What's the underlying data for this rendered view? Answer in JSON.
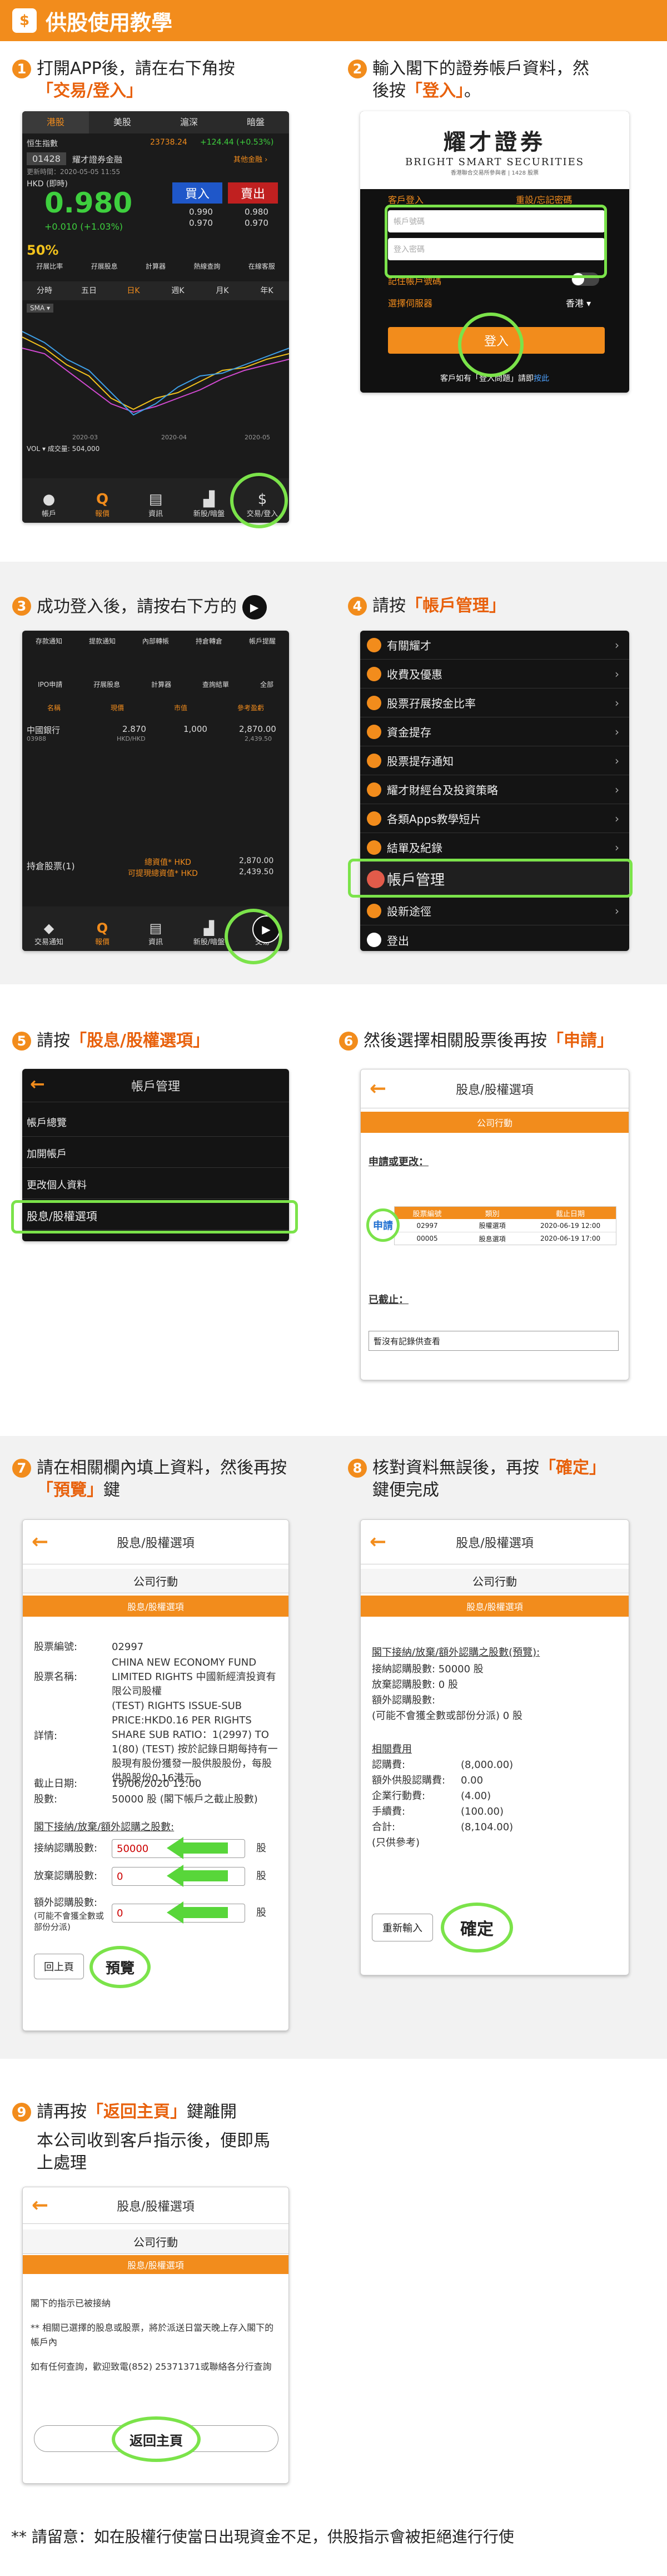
{
  "header": {
    "title": "供股使用教學",
    "icon": "$"
  },
  "steps": {
    "s1": {
      "num": "1",
      "text": "打開APP後，請在右下角按",
      "highlight": "「交易/登入」"
    },
    "s2": {
      "num": "2",
      "text": "輸入閣下的證券帳戶資料，然後按",
      "highlight": "「登入」",
      "tail": "。"
    },
    "s3": {
      "num": "3",
      "text": "成功登入後，請按右下方的"
    },
    "s4": {
      "num": "4",
      "text": "請按",
      "highlight": "「帳戶管理」"
    },
    "s5": {
      "num": "5",
      "text": "請按",
      "highlight": "「股息/股權選項」"
    },
    "s6": {
      "num": "6",
      "text": "然後選擇相關股票後再按",
      "highlight": "「申請」"
    },
    "s7": {
      "num": "7",
      "text": "請在相關欄內填上資料，然後再按",
      "highlight": "「預覽」",
      "tail": "鍵"
    },
    "s8": {
      "num": "8",
      "text": "核對資料無誤後，再按",
      "highlight": "「確定」",
      "tail": "鍵便完成"
    },
    "s9": {
      "num": "9",
      "text": "請再按",
      "highlight": "「返回主頁」",
      "tail": "鍵離開",
      "line2": "本公司收到客戶指示後，便即馬上處理"
    }
  },
  "screen1": {
    "tabs": [
      "港股",
      "美股",
      "滬深",
      "暗盤"
    ],
    "index": {
      "name": "恒生指數",
      "value": "23738.24",
      "change": "+124.44 (+0.53%)"
    },
    "stock": {
      "code": "01428",
      "name": "耀才證券金融",
      "other": "其他金融 ›",
      "updated": "更新時間：2020-05-05 11:55",
      "currency": "HKD (即時)",
      "price": "0.980",
      "chg": "+0.010 (+1.03%)",
      "lowhi": "低",
      "bid": "0.990",
      "ask": "0.970",
      "hi1": "0.980",
      "hi2": "0.970",
      "buy": "買入",
      "sell": "賣出"
    },
    "quick": [
      "50%",
      "",
      "",
      "",
      ""
    ],
    "quick_labels": [
      "孖展比率",
      "孖展股息",
      "計算器",
      "熱線查詢",
      "在線客服"
    ],
    "periods": [
      "分時",
      "五日",
      "日K",
      "週K",
      "月K",
      "年K"
    ],
    "sma": "SMA ▾",
    "dates": [
      "2020-03",
      "2020-04",
      "2020-05"
    ],
    "vol": "VOL ▾  成交量: 504,000",
    "nav": [
      "帳戶",
      "報價",
      "資訊",
      "新股/暗盤",
      "交易/登入"
    ]
  },
  "screen2": {
    "logo_cn": "耀才證券",
    "logo_en": "BRIGHT SMART SECURITIES",
    "logo_sub": "香港聯合交易所參與者 | 1428 股票",
    "tab_login": "客戶登入",
    "tab_forgot": "重設/忘記密碼",
    "ph_account": "帳戶號碼",
    "ph_password": "登入密碼",
    "remember": "記住帳戶號碼",
    "server": "選擇伺服器",
    "server_value": "香港 ▾",
    "login_btn": "登入",
    "footer": "客戶如有「登入問題」請即",
    "footer_link": "按此"
  },
  "screen3": {
    "icons1": [
      "存款通知",
      "提款通知",
      "內部轉帳",
      "持倉轉倉",
      "帳戶提醒"
    ],
    "icons2": [
      "IPO申請",
      "孖展股息",
      "計算器",
      "查詢結單",
      "全部"
    ],
    "col_heads": [
      "名稱",
      "現價",
      "市值",
      "參考盈虧"
    ],
    "row": {
      "name": "中國銀行",
      "code": "03988",
      "price": "2.870",
      "ccy": "HKD/HKD",
      "qty": "1,000",
      "mv": "2,870.00",
      "pl": "2,439.50"
    },
    "holding": "持倉股票(1)",
    "total_mv": "總資值* HKD",
    "total_mv_v": "2,870.00",
    "total_pl": "可提現總資值* HKD",
    "total_pl_v": "2,439.50",
    "nav": [
      "交易通知",
      "報價",
      "資訊",
      "新股/暗盤",
      "交易"
    ],
    "play": "▶"
  },
  "screen4": {
    "items": [
      "有關耀才",
      "收費及優惠",
      "股票孖展按金比率",
      "資金提存",
      "股票提存通知",
      "耀才財經台及投資策略",
      "各類Apps教學短片",
      "結單及紀錄",
      "帳戶管理",
      "設新途徑",
      "登出"
    ]
  },
  "screen5": {
    "title": "帳戶管理",
    "items": [
      "帳戶總覽",
      "加開帳戶",
      "更改個人資料",
      "股息/股權選項"
    ]
  },
  "screen6": {
    "title": "股息/股權選項",
    "bar": "公司行動",
    "section1": "申請或更改：",
    "apply": "申請",
    "cols": [
      "股票編號",
      "類別",
      "截止日期"
    ],
    "rows": [
      [
        "02997",
        "股權選項",
        "2020-06-19 12:00"
      ],
      [
        "00005",
        "股息選項",
        "2020-06-19 17:00"
      ]
    ],
    "section2": "已截止：",
    "empty": "暫沒有記錄供查看"
  },
  "screen7": {
    "title": "股息/股權選項",
    "sub": "公司行動",
    "bar": "股息/股權選項",
    "fields": [
      {
        "k": "股票編號:",
        "v": "02997"
      },
      {
        "k": "股票名稱:",
        "v": "CHINA NEW ECONOMY FUND LIMITED RIGHTS 中國新經濟投資有限公司股權"
      },
      {
        "k": "詳情:",
        "v": "(TEST) RIGHTS ISSUE-SUB PRICE:HKD0.16 PER RIGHTS SHARE SUB RATIO：1(2997) TO 1(80) (TEST) 按於記錄日期每持有一股現有股份獲發一股供股股份，每股供股股份0.16港元。"
      },
      {
        "k": "截止日期:",
        "v": "19/06/2020 12:00"
      },
      {
        "k": "股數:",
        "v": "50000 股 (閣下帳戶之截止股數)"
      }
    ],
    "section": "閣下接納/放棄/額外認購之股數:",
    "accept": "接納認購股數:",
    "accept_v": "50000",
    "waive": "放棄認購股數:",
    "waive_v": "0",
    "extra": "額外認購股數:",
    "extra_note": "(可能不會獲全數或部份分派)",
    "extra_v": "0",
    "unit": "股",
    "back": "回上頁",
    "preview": "預覽"
  },
  "screen8": {
    "title": "股息/股權選項",
    "sub": "公司行動",
    "bar": "股息/股權選項",
    "section": "閣下接納/放棄/額外認購之股數(預覽):",
    "lines": [
      "接納認購股數: 50000 股",
      "放棄認購股數: 0 股",
      "額外認購股數:",
      "(可能不會獲全數或部份分派) 0 股"
    ],
    "fee_title": "相關費用",
    "fees": [
      [
        "認購費:",
        "(8,000.00)"
      ],
      [
        "額外供股認購費:",
        "0.00"
      ],
      [
        "企業行動費:",
        "(4.00)"
      ],
      [
        "手續費:",
        "(100.00)"
      ],
      [
        "合計:",
        "(8,104.00)"
      ]
    ],
    "fee_note": "(只供參考)",
    "reset": "重新輸入",
    "confirm": "確定"
  },
  "screen9": {
    "title": "股息/股權選項",
    "sub": "公司行動",
    "bar": "股息/股權選項",
    "lines": [
      "閣下的指示已被接納",
      "** 相關已選擇的股息或股票，將於派送日當天晚上存入閣下的帳戶內",
      "如有任何查詢，歡迎致電(852) 25371371或聯絡各分行查詢"
    ],
    "home": "返回主頁"
  },
  "footnote": "** 請留意：如在股權行使當日出現資金不足，供股指示會被拒絕進行行使"
}
